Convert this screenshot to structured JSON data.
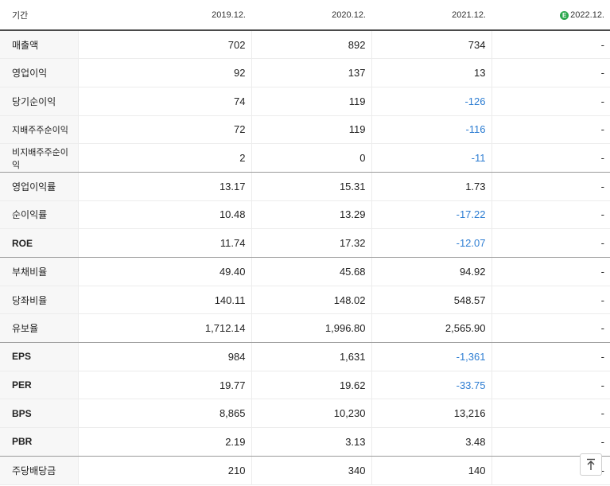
{
  "header": {
    "period_label": "기간",
    "years": [
      "2019.12.",
      "2020.12.",
      "2021.12.",
      "2022.12."
    ],
    "estimate_badge": "E"
  },
  "rows": [
    {
      "label": "매출액",
      "values": [
        "702",
        "892",
        "734",
        "-"
      ]
    },
    {
      "label": "영업이익",
      "values": [
        "92",
        "137",
        "13",
        "-"
      ]
    },
    {
      "label": "당기순이익",
      "values": [
        "74",
        "119",
        "-126",
        "-"
      ]
    },
    {
      "label": "지배주주순이익",
      "values": [
        "72",
        "119",
        "-116",
        "-"
      ]
    },
    {
      "label": "비지배주주순이익",
      "values": [
        "2",
        "0",
        "-11",
        "-"
      ]
    },
    {
      "label": "영업이익률",
      "values": [
        "13.17",
        "15.31",
        "1.73",
        "-"
      ]
    },
    {
      "label": "순이익률",
      "values": [
        "10.48",
        "13.29",
        "-17.22",
        "-"
      ]
    },
    {
      "label": "ROE",
      "values": [
        "11.74",
        "17.32",
        "-12.07",
        "-"
      ]
    },
    {
      "label": "부채비율",
      "values": [
        "49.40",
        "45.68",
        "94.92",
        "-"
      ]
    },
    {
      "label": "당좌비율",
      "values": [
        "140.11",
        "148.02",
        "548.57",
        "-"
      ]
    },
    {
      "label": "유보율",
      "values": [
        "1,712.14",
        "1,996.80",
        "2,565.90",
        "-"
      ]
    },
    {
      "label": "EPS",
      "values": [
        "984",
        "1,631",
        "-1,361",
        "-"
      ]
    },
    {
      "label": "PER",
      "values": [
        "19.77",
        "19.62",
        "-33.75",
        "-"
      ]
    },
    {
      "label": "BPS",
      "values": [
        "8,865",
        "10,230",
        "13,216",
        "-"
      ]
    },
    {
      "label": "PBR",
      "values": [
        "2.19",
        "3.13",
        "3.48",
        "-"
      ]
    },
    {
      "label": "주당배당금",
      "values": [
        "210",
        "340",
        "140",
        "-"
      ]
    }
  ],
  "colors": {
    "negative": "#2d7dd2",
    "estimate_badge": "#2ca84e"
  },
  "scroll_top_button": {
    "icon": "arrow-up-to-top-icon"
  }
}
